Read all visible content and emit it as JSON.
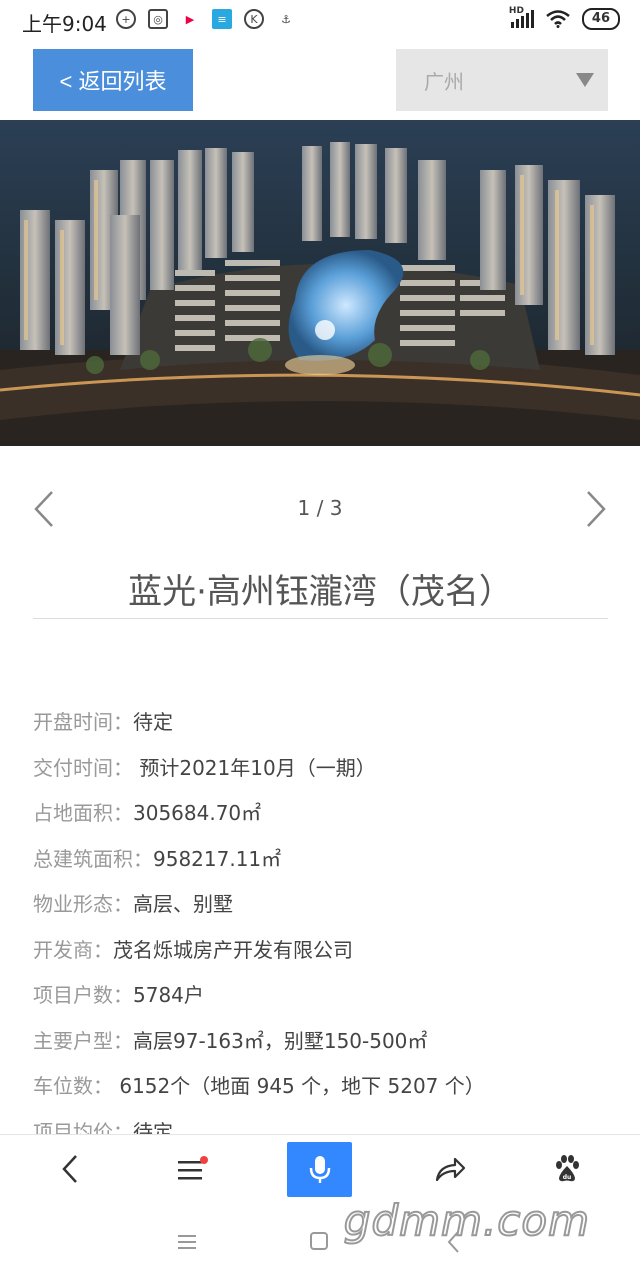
{
  "status": {
    "time": "上午9:04",
    "network": "HD",
    "battery": "46"
  },
  "header": {
    "back_label": "< 返回列表",
    "city": "广州"
  },
  "pager": {
    "count": "1 / 3"
  },
  "title": "蓝光·高州钰瀧湾（茂名）",
  "info": [
    {
      "label": "开盘时间：",
      "value": "待定"
    },
    {
      "label": "交付时间：",
      "value": " 预计2021年10月（一期）"
    },
    {
      "label": "占地面积：",
      "value": "305684.70㎡"
    },
    {
      "label": "总建筑面积：",
      "value": "958217.11㎡"
    },
    {
      "label": "物业形态：",
      "value": "高层、别墅"
    },
    {
      "label": "开发商：",
      "value": "茂名烁城房产开发有限公司"
    },
    {
      "label": "项目户数：",
      "value": "5784户"
    },
    {
      "label": "主要户型：",
      "value": "高层97-163㎡，别墅150-500㎡"
    },
    {
      "label": "车位数：",
      "value": " 6152个（地面 945 个，地下 5207 个）"
    },
    {
      "label": "项目均价：",
      "value": "待定"
    }
  ],
  "watermark": "gdmm.com",
  "colors": {
    "accent": "#4b8fdc",
    "mic": "#3388ff",
    "badge": "#f04040"
  },
  "icons": [
    "back-arrow-icon",
    "menu-icon",
    "mic-icon",
    "share-icon",
    "baidu-paw-icon"
  ]
}
